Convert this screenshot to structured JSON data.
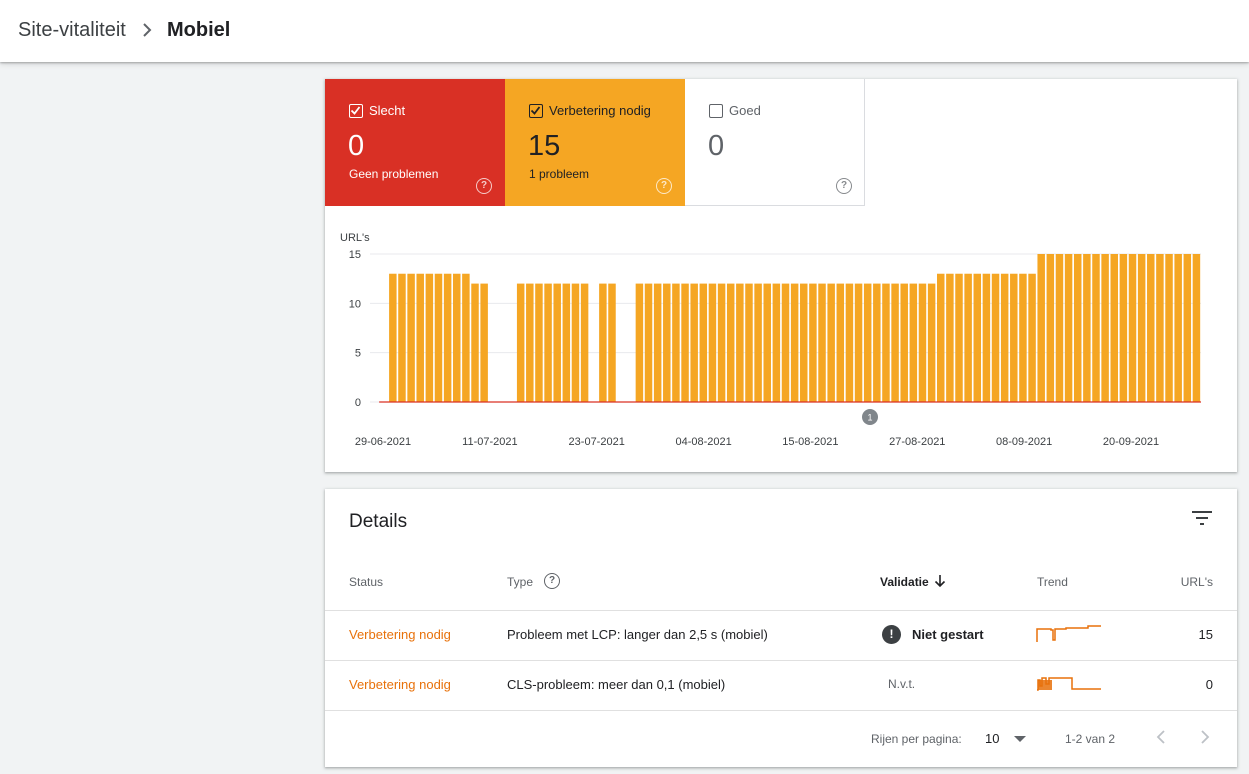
{
  "breadcrumb": {
    "parent": "Site-vitaliteit",
    "current": "Mobiel"
  },
  "tiles": [
    {
      "label": "Slecht",
      "count": "0",
      "sub": "Geen problemen",
      "checked": true,
      "color": "#d93025"
    },
    {
      "label": "Verbetering nodig",
      "count": "15",
      "sub": "1 probleem",
      "checked": true,
      "color": "#f5a623"
    },
    {
      "label": "Goed",
      "count": "0",
      "sub": "",
      "checked": false,
      "color": "#ffffff"
    }
  ],
  "chart_data": {
    "type": "bar",
    "ylabel": "URL's",
    "ylim": [
      0,
      15
    ],
    "yticks": [
      "0",
      "5",
      "10",
      "15"
    ],
    "x_tick_labels": [
      "29-06-2021",
      "11-07-2021",
      "23-07-2021",
      "04-08-2021",
      "15-08-2021",
      "27-08-2021",
      "08-09-2021",
      "20-09-2021"
    ],
    "annotation": "1",
    "series": [
      {
        "name": "Verbetering nodig",
        "color": "#f5a623",
        "values": [
          0,
          0,
          13,
          13,
          13,
          13,
          13,
          13,
          13,
          13,
          13,
          12,
          12,
          0,
          0,
          0,
          12,
          12,
          12,
          12,
          12,
          12,
          12,
          12,
          0,
          12,
          12,
          0,
          0,
          12,
          12,
          12,
          12,
          12,
          12,
          12,
          12,
          12,
          12,
          12,
          12,
          12,
          12,
          12,
          12,
          12,
          12,
          12,
          12,
          12,
          12,
          12,
          12,
          12,
          12,
          12,
          12,
          12,
          12,
          12,
          12,
          12,
          13,
          13,
          13,
          13,
          13,
          13,
          13,
          13,
          13,
          13,
          13,
          15,
          15,
          15,
          15,
          15,
          15,
          15,
          15,
          15,
          15,
          15,
          15,
          15,
          15,
          15,
          15,
          15,
          15
        ]
      },
      {
        "name": "Slecht",
        "color": "#d93025",
        "values": [
          0,
          0,
          0,
          0,
          0,
          0,
          0,
          0,
          0,
          0,
          0,
          0,
          0,
          0,
          0,
          0,
          0,
          0,
          0,
          0,
          0,
          0,
          0,
          0,
          0,
          0,
          0,
          0,
          0,
          0,
          0,
          0,
          0,
          0,
          0,
          0,
          0,
          0,
          0,
          0,
          0,
          0,
          0,
          0,
          0,
          0,
          0,
          0,
          0,
          0,
          0,
          0,
          0,
          0,
          0,
          0,
          0,
          0,
          0,
          0,
          0,
          0,
          0,
          0,
          0,
          0,
          0,
          0,
          0,
          0,
          0,
          0,
          0,
          0,
          0,
          0,
          0,
          0,
          0,
          0,
          0,
          0,
          0,
          0,
          0,
          0,
          0,
          0,
          0,
          0,
          0,
          0,
          0
        ]
      }
    ],
    "grid": true
  },
  "details": {
    "title": "Details",
    "headers": {
      "status": "Status",
      "type": "Type",
      "validatie": "Validatie",
      "trend": "Trend",
      "urls": "URL's"
    },
    "rows": [
      {
        "status": "Verbetering nodig",
        "type": "Probleem met LCP: langer dan 2,5 s (mobiel)",
        "validatie": "Niet gestart",
        "alert": "!",
        "urls": "15"
      },
      {
        "status": "Verbetering nodig",
        "type": "CLS-probleem: meer dan 0,1 (mobiel)",
        "validatie": "N.v.t.",
        "alert": "",
        "urls": "0"
      }
    ],
    "pagination": {
      "label": "Rijen per pagina:",
      "value": "10",
      "range": "1-2 van 2"
    }
  },
  "icons": {
    "separator": "chevron-right-icon",
    "filter": "filter-icon",
    "help": "help-circle-icon",
    "sort": "arrow-down-icon",
    "alert": "alert-circle-icon"
  }
}
